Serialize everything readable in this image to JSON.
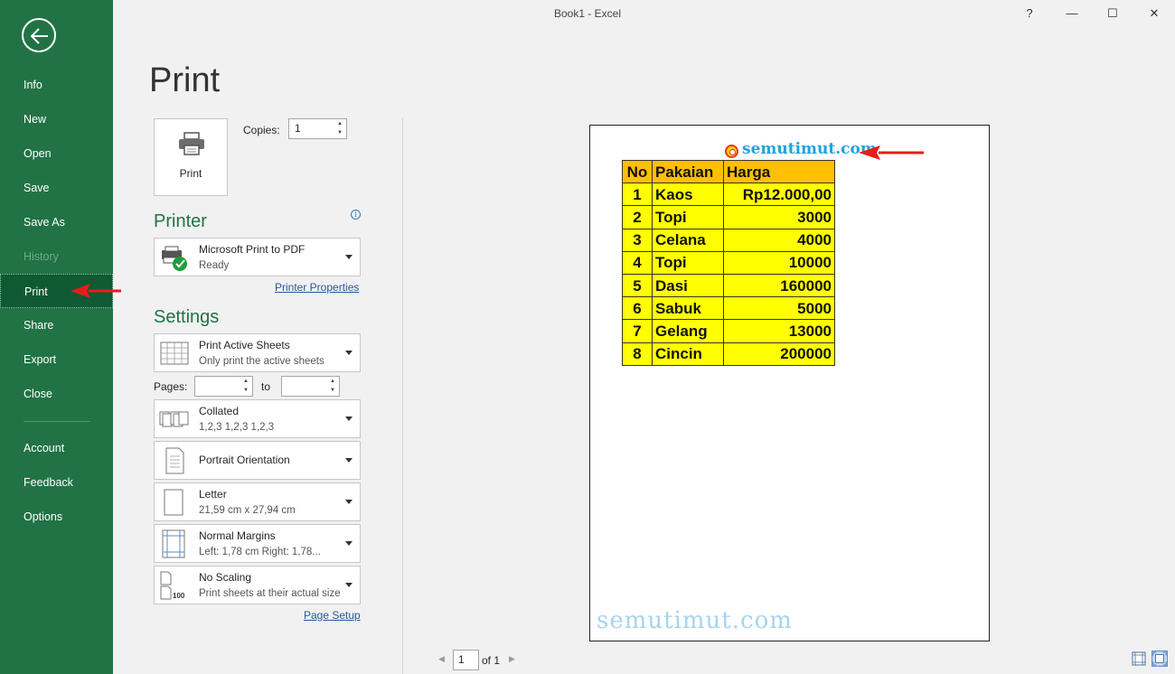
{
  "window": {
    "title": "Book1  -  Excel",
    "help": "?",
    "minimize": "—",
    "maximize": "☐",
    "close": "✕"
  },
  "sidebar": {
    "items": [
      {
        "label": "Info"
      },
      {
        "label": "New"
      },
      {
        "label": "Open"
      },
      {
        "label": "Save"
      },
      {
        "label": "Save As"
      },
      {
        "label": "History"
      },
      {
        "label": "Print"
      },
      {
        "label": "Share"
      },
      {
        "label": "Export"
      },
      {
        "label": "Close"
      },
      {
        "label": "Account"
      },
      {
        "label": "Feedback"
      },
      {
        "label": "Options"
      }
    ],
    "selected": "Print",
    "disabled": [
      "History"
    ]
  },
  "page": {
    "title": "Print"
  },
  "print_button": {
    "label": "Print"
  },
  "copies": {
    "label": "Copies:",
    "value": "1"
  },
  "printer": {
    "heading": "Printer",
    "name": "Microsoft Print to PDF",
    "status": "Ready",
    "properties_link": "Printer Properties"
  },
  "settings": {
    "heading": "Settings",
    "what": {
      "title": "Print Active Sheets",
      "subtitle": "Only print the active sheets"
    },
    "pages_label": "Pages:",
    "to_label": "to",
    "collation": {
      "title": "Collated",
      "subtitle": "1,2,3    1,2,3    1,2,3"
    },
    "orientation": {
      "title": "Portrait Orientation"
    },
    "paper": {
      "title": "Letter",
      "subtitle": "21,59 cm x 27,94 cm"
    },
    "margins": {
      "title": "Normal Margins",
      "subtitle": "Left:  1,78 cm    Right:  1,78..."
    },
    "scaling": {
      "title": "No Scaling",
      "subtitle": "Print sheets at their actual size",
      "icon_text": "100"
    },
    "page_setup_link": "Page Setup"
  },
  "preview": {
    "site_label": "semutimut.com",
    "watermark": "semutimut.com",
    "table": {
      "headers": [
        "No",
        "Pakaian",
        "Harga"
      ],
      "rows": [
        [
          "1",
          "Kaos",
          "Rp12.000,00"
        ],
        [
          "2",
          "Topi",
          "3000"
        ],
        [
          "3",
          "Celana",
          "4000"
        ],
        [
          "4",
          "Topi",
          "10000"
        ],
        [
          "5",
          "Dasi",
          "160000"
        ],
        [
          "6",
          "Sabuk",
          "5000"
        ],
        [
          "7",
          "Gelang",
          "13000"
        ],
        [
          "8",
          "Cincin",
          "200000"
        ]
      ]
    }
  },
  "page_nav": {
    "current": "1",
    "of_label": "of 1"
  },
  "colors": {
    "sidebar": "#217346",
    "accent_red": "#e81c1c",
    "header_fill": "#ffc000",
    "cell_fill": "#ffff00"
  }
}
